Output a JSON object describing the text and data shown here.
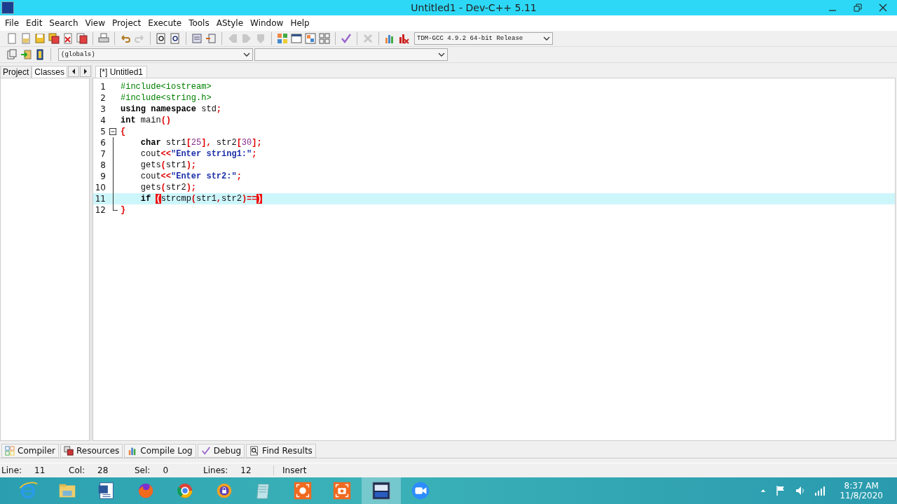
{
  "window": {
    "title": "Untitled1 - Dev-C++ 5.11"
  },
  "menu": [
    "File",
    "Edit",
    "Search",
    "View",
    "Project",
    "Execute",
    "Tools",
    "AStyle",
    "Window",
    "Help"
  ],
  "toolbar": [
    [
      {
        "disabled": false
      },
      {
        "disabled": false
      },
      {
        "disabled": false
      },
      {
        "disabled": false
      },
      {
        "disabled": false
      },
      {
        "disabled": false
      }
    ],
    [
      {
        "disabled": false
      }
    ],
    [
      {
        "disabled": false
      },
      {
        "disabled": true
      }
    ],
    [
      {
        "disabled": false
      },
      {
        "disabled": false
      }
    ],
    [
      {
        "disabled": false
      },
      {
        "disabled": false
      }
    ],
    [
      {
        "disabled": true
      },
      {
        "disabled": true
      },
      {
        "disabled": true
      }
    ],
    [
      {
        "disabled": false
      },
      {
        "disabled": false
      },
      {
        "disabled": false
      },
      {
        "disabled": false
      }
    ],
    [
      {
        "disabled": false
      }
    ],
    [
      {
        "disabled": true
      }
    ],
    [
      {
        "disabled": false
      },
      {
        "disabled": false
      }
    ]
  ],
  "compiler_select": {
    "value": "TDM-GCC 4.9.2 64-bit Release"
  },
  "scope_select": {
    "value": "(globals)"
  },
  "side_tabs": [
    {
      "label": "Project",
      "selected": false
    },
    {
      "label": "Classes",
      "selected": true
    }
  ],
  "editor_tabs": [
    {
      "label": "[*] Untitled1",
      "selected": true
    }
  ],
  "code": [
    {
      "number": "1",
      "current": false,
      "tokens": [
        {
          "kind": "pre",
          "text": "#include<iostream>"
        }
      ]
    },
    {
      "number": "2",
      "current": false,
      "tokens": [
        {
          "kind": "pre",
          "text": "#include<string.h>"
        }
      ]
    },
    {
      "number": "3",
      "current": false,
      "tokens": [
        {
          "kind": "kw",
          "text": "using namespace"
        },
        {
          "kind": "plain",
          "text": " std"
        },
        {
          "kind": "sym",
          "text": ";"
        }
      ]
    },
    {
      "number": "4",
      "current": false,
      "tokens": [
        {
          "kind": "kw",
          "text": "int"
        },
        {
          "kind": "plain",
          "text": " main"
        },
        {
          "kind": "sym",
          "text": "()"
        }
      ]
    },
    {
      "number": "5",
      "current": false,
      "fold_start": true,
      "tokens": [
        {
          "kind": "sym",
          "text": "{"
        }
      ]
    },
    {
      "number": "6",
      "current": false,
      "tokens": [
        {
          "kind": "kw",
          "text": "    char"
        },
        {
          "kind": "plain",
          "text": " str1"
        },
        {
          "kind": "sym",
          "text": "["
        },
        {
          "kind": "num",
          "text": "25"
        },
        {
          "kind": "sym",
          "text": "],"
        },
        {
          "kind": "plain",
          "text": " str2"
        },
        {
          "kind": "sym",
          "text": "["
        },
        {
          "kind": "num",
          "text": "30"
        },
        {
          "kind": "sym",
          "text": "];"
        }
      ]
    },
    {
      "number": "7",
      "current": false,
      "tokens": [
        {
          "kind": "plain",
          "text": "    cout"
        },
        {
          "kind": "sym",
          "text": "<<"
        },
        {
          "kind": "str",
          "text": "\"Enter string1:\""
        },
        {
          "kind": "sym",
          "text": ";"
        }
      ]
    },
    {
      "number": "8",
      "current": false,
      "tokens": [
        {
          "kind": "plain",
          "text": "    gets"
        },
        {
          "kind": "sym",
          "text": "("
        },
        {
          "kind": "plain",
          "text": "str1"
        },
        {
          "kind": "sym",
          "text": ");"
        }
      ]
    },
    {
      "number": "9",
      "current": false,
      "tokens": [
        {
          "kind": "plain",
          "text": "    cout"
        },
        {
          "kind": "sym",
          "text": "<<"
        },
        {
          "kind": "str",
          "text": "\"Enter str2:\""
        },
        {
          "kind": "sym",
          "text": ";"
        }
      ]
    },
    {
      "number": "10",
      "current": false,
      "tokens": [
        {
          "kind": "plain",
          "text": "    gets"
        },
        {
          "kind": "sym",
          "text": "("
        },
        {
          "kind": "plain",
          "text": "str2"
        },
        {
          "kind": "sym",
          "text": ");"
        }
      ]
    },
    {
      "number": "11",
      "current": true,
      "tokens": [
        {
          "kind": "kw",
          "text": "    if "
        },
        {
          "kind": "brace",
          "text": "("
        },
        {
          "kind": "plain",
          "text": "strcmp"
        },
        {
          "kind": "sym",
          "text": "("
        },
        {
          "kind": "plain",
          "text": "str1"
        },
        {
          "kind": "sym",
          "text": ","
        },
        {
          "kind": "plain",
          "text": "str2"
        },
        {
          "kind": "sym",
          "text": ")=="
        },
        {
          "kind": "brace",
          "text": ")"
        }
      ]
    },
    {
      "number": "12",
      "current": false,
      "fold_end": true,
      "tokens": [
        {
          "kind": "sym",
          "text": "}"
        }
      ]
    }
  ],
  "bottom_tabs": [
    {
      "label": "Compiler"
    },
    {
      "label": "Resources"
    },
    {
      "label": "Compile Log"
    },
    {
      "label": "Debug"
    },
    {
      "label": "Find Results"
    }
  ],
  "status_bar": [
    {
      "label": "Line:",
      "value": "11"
    },
    {
      "label": "Col:",
      "value": "28"
    },
    {
      "label": "Sel:",
      "value": "0"
    },
    {
      "label": "Lines:",
      "value": "12"
    },
    {
      "value": "Insert"
    }
  ],
  "taskbar": {
    "apps": [
      {
        "selected": false
      },
      {
        "selected": false
      },
      {
        "selected": false
      },
      {
        "selected": false
      },
      {
        "selected": false
      },
      {
        "selected": false
      },
      {
        "selected": false
      },
      {
        "selected": false
      },
      {
        "selected": false
      },
      {
        "selected": true
      },
      {
        "selected": false
      }
    ],
    "time": "8:37 AM",
    "date": "11/8/2020"
  }
}
